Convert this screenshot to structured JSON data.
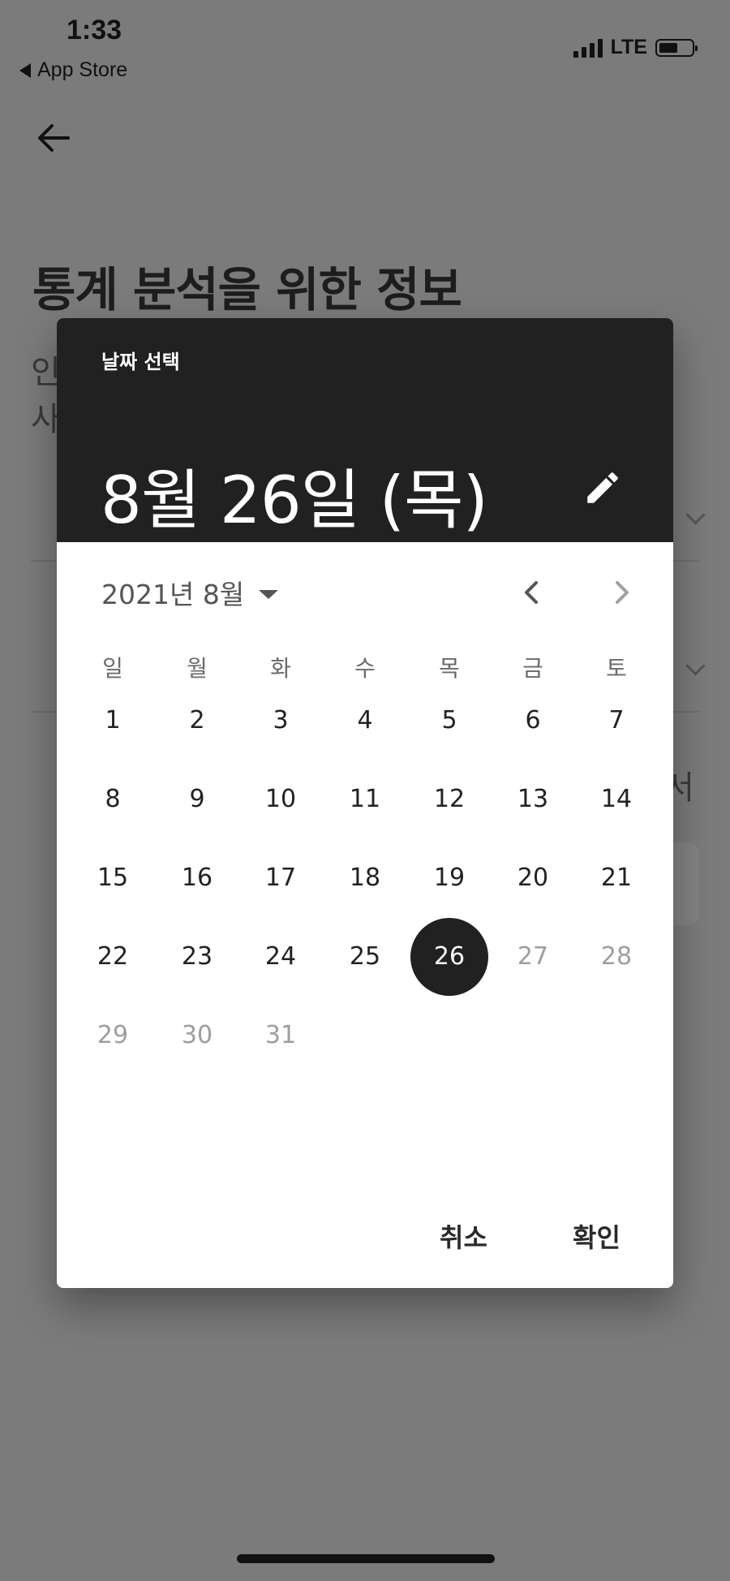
{
  "status": {
    "time": "1:33",
    "back_app": "App Store",
    "network": "LTE"
  },
  "page": {
    "title": "통계 분석을 위한 정보",
    "partial_text_1": "인",
    "partial_text_2": "사",
    "partial_text_right": "서"
  },
  "dialog": {
    "caption": "날짜 선택",
    "selected_date": "8월 26일 (목)",
    "month_year": "2021년 8월",
    "weekdays": [
      "일",
      "월",
      "화",
      "수",
      "목",
      "금",
      "토"
    ],
    "days": [
      "1",
      "2",
      "3",
      "4",
      "5",
      "6",
      "7",
      "8",
      "9",
      "10",
      "11",
      "12",
      "13",
      "14",
      "15",
      "16",
      "17",
      "18",
      "19",
      "20",
      "21",
      "22",
      "23",
      "24",
      "25",
      "26",
      "27",
      "28",
      "29",
      "30",
      "31"
    ],
    "selected_day": "26",
    "first_disabled_day": 27,
    "cancel_label": "취소",
    "ok_label": "확인"
  },
  "icons": {
    "back": "arrow-left-icon",
    "edit": "pencil-icon",
    "prev": "chevron-left-icon",
    "next": "chevron-right-icon",
    "month_dropdown": "caret-down-icon"
  },
  "colors": {
    "scrim": "#7b7b7b",
    "header": "#212121",
    "selected": "#212121",
    "disabled": "#9e9e9e"
  }
}
